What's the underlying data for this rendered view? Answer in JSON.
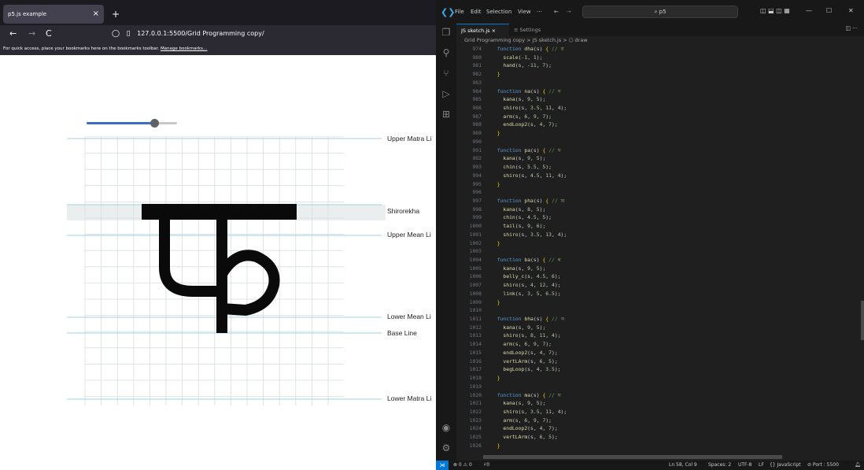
{
  "browser": {
    "tab_title": "p5.js example",
    "tab_close": "×",
    "new_tab": "+",
    "back": "←",
    "forward": "→",
    "reload": "C",
    "url": "127.0.0.1:5500/Grid Programming copy/",
    "bookmarks_text": "For quick access, place your bookmarks here on the bookmarks toolbar.",
    "bookmarks_link": "Manage bookmarks…"
  },
  "sketch": {
    "slider_value": 0.75,
    "glyph": "फ",
    "guides": [
      {
        "label": "Upper Matra Li"
      },
      {
        "label": "Shirorekha"
      },
      {
        "label": "Upper Mean Li"
      },
      {
        "label": "Lower Mean Li"
      },
      {
        "label": "Base Line"
      },
      {
        "label": "Lower Matra Li"
      }
    ]
  },
  "vscode": {
    "menu": [
      "File",
      "Edit",
      "Selection",
      "View",
      "···"
    ],
    "search": "p5",
    "tabs": [
      {
        "label": "JS sketch.js  ×"
      },
      {
        "label": "≡ Settings"
      }
    ],
    "breadcrumb": "Grid Programming copy > JS sketch.js > ⬡ draw",
    "code_lines": [
      {
        "n": "974",
        "t": "  function dha(s) { // ध"
      },
      {
        "n": "980",
        "t": "    scale(-1, 1);"
      },
      {
        "n": "981",
        "t": "    hand(s, -11, 7);"
      },
      {
        "n": "982",
        "t": "  }"
      },
      {
        "n": "983",
        "t": ""
      },
      {
        "n": "984",
        "t": "  function na(s) { // न"
      },
      {
        "n": "985",
        "t": "    kana(s, 9, 5);"
      },
      {
        "n": "986",
        "t": "    shiro(s, 3.5, 11, 4);"
      },
      {
        "n": "987",
        "t": "    arm(s, 6, 9, 7);"
      },
      {
        "n": "988",
        "t": "    endLoop2(s, 4, 7);"
      },
      {
        "n": "989",
        "t": "  }"
      },
      {
        "n": "990",
        "t": ""
      },
      {
        "n": "991",
        "t": "  function pa(s) { // प"
      },
      {
        "n": "992",
        "t": "    kana(s, 9, 5);"
      },
      {
        "n": "993",
        "t": "    chin(s, 5.5, 5);"
      },
      {
        "n": "994",
        "t": "    shiro(s, 4.5, 11, 4);"
      },
      {
        "n": "995",
        "t": "  }"
      },
      {
        "n": "996",
        "t": ""
      },
      {
        "n": "997",
        "t": "  function pha(s) { // फ"
      },
      {
        "n": "998",
        "t": "    kana(s, 8, 5);"
      },
      {
        "n": "999",
        "t": "    chin(s, 4.5, 5);"
      },
      {
        "n": "1000",
        "t": "    tail(s, 9, 6);"
      },
      {
        "n": "1001",
        "t": "    shiro(s, 3.5, 13, 4);"
      },
      {
        "n": "1002",
        "t": "  }"
      },
      {
        "n": "1003",
        "t": ""
      },
      {
        "n": "1004",
        "t": "  function ba(s) { // ब"
      },
      {
        "n": "1005",
        "t": "    kana(s, 9, 5);"
      },
      {
        "n": "1006",
        "t": "    belly_c(s, 4.5, 6);"
      },
      {
        "n": "1007",
        "t": "    shiro(s, 4, 12, 4);"
      },
      {
        "n": "1008",
        "t": "    link(s, 3, 5, 6.5);"
      },
      {
        "n": "1009",
        "t": "  }"
      },
      {
        "n": "1010",
        "t": ""
      },
      {
        "n": "1011",
        "t": "  function bha(s) { // भ"
      },
      {
        "n": "1012",
        "t": "    kana(s, 9, 5);"
      },
      {
        "n": "1013",
        "t": "    shiro(s, 8, 11, 4);"
      },
      {
        "n": "1014",
        "t": "    arm(s, 6, 9, 7);"
      },
      {
        "n": "1015",
        "t": "    endLoop2(s, 4, 7);"
      },
      {
        "n": "1016",
        "t": "    vertLArm(s, 6, 5);"
      },
      {
        "n": "1017",
        "t": "    begLoop(s, 4, 3.5);"
      },
      {
        "n": "1018",
        "t": "  }"
      },
      {
        "n": "1019",
        "t": ""
      },
      {
        "n": "1020",
        "t": "  function ma(s) { // म"
      },
      {
        "n": "1021",
        "t": "    kana(s, 9, 5);"
      },
      {
        "n": "1022",
        "t": "    shiro(s, 3.5, 11, 4);"
      },
      {
        "n": "1023",
        "t": "    arm(s, 6, 9, 7);"
      },
      {
        "n": "1024",
        "t": "    endLoop2(s, 4, 7);"
      },
      {
        "n": "1025",
        "t": "    vertLArm(s, 6, 5);"
      },
      {
        "n": "1026",
        "t": "  }"
      }
    ],
    "status": {
      "errors": "⊗ 0 ⚠ 0",
      "ports": "⚡0",
      "position": "Ln 58, Col 9",
      "spaces": "Spaces: 2",
      "encoding": "UTF-8",
      "eol": "LF",
      "language": "{} JavaScript",
      "port": "⊘ Port : 5500"
    }
  }
}
